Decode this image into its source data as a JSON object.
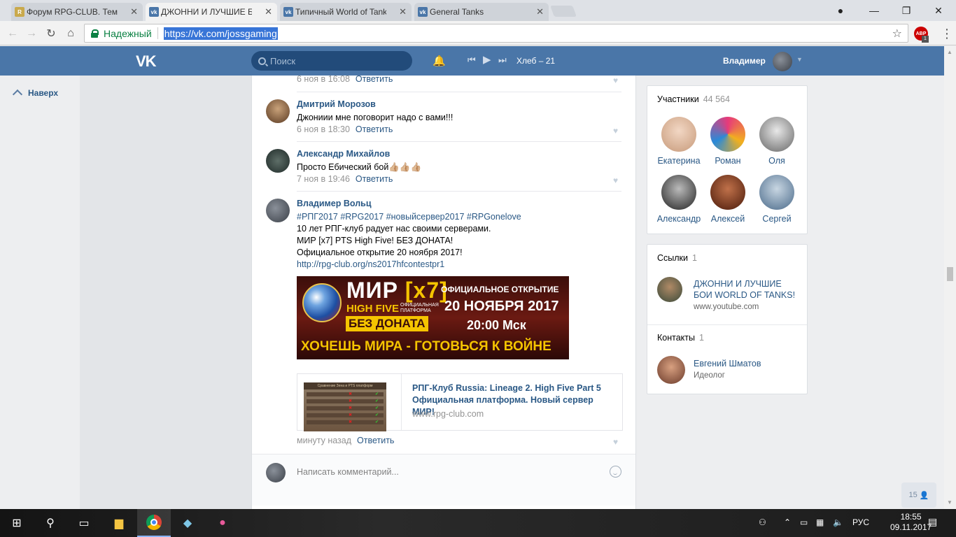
{
  "browser": {
    "tabs": [
      {
        "title": "Форум RPG-CLUB. Тема",
        "favicon": "rpg",
        "active": false
      },
      {
        "title": "ДЖОННИ И ЛУЧШИЕ Б",
        "favicon": "vk",
        "active": true
      },
      {
        "title": "Типичный World of Tank",
        "favicon": "vk",
        "active": false
      },
      {
        "title": "General Tanks",
        "favicon": "vk",
        "active": false
      }
    ],
    "secure_label": "Надежный",
    "url": "https://vk.com/jossgaming",
    "ext_badge": "ABP",
    "ext_count": "1"
  },
  "vk": {
    "search_placeholder": "Поиск",
    "now_playing": "Хлеб – 21",
    "user_name": "Владимер",
    "back_to_top": "Наверх"
  },
  "comments": [
    {
      "meta": "6 ноя в 16:08",
      "reply": "Ответить"
    },
    {
      "author": "Дмитрий Морозов",
      "text": "Джониии мне поговорит надо с вами!!!",
      "meta": "6 ноя в 18:30",
      "reply": "Ответить"
    },
    {
      "author": "Александр Михайлов",
      "text": "Просто Ебический бой👍🏼👍🏼👍🏼",
      "meta": "7 ноя в 19:46",
      "reply": "Ответить"
    },
    {
      "author": "Владимер Вольц",
      "hashtags": "#РПГ2017 #RPG2017 #новыйсервер2017 #RPGonelove",
      "line1": "10 лет РПГ-клуб радует нас своими серверами.",
      "line2": "МИР [x7] PTS High Five! БЕЗ ДОНАТА!",
      "line3": "Официальное открытие 20 ноября 2017!",
      "link": "http://rpg-club.org/ns2017hfcontestpr1",
      "meta": "минуту назад",
      "reply": "Ответить"
    }
  ],
  "banner": {
    "mir": "МИР",
    "x7": "[x7]",
    "high_five": "HIGH FIVE",
    "platform": "ОФИЦИАЛЬНАЯ ПЛАТФОРМА",
    "no_donate": "БЕЗ ДОНАТА",
    "official_opening": "ОФИЦИАЛЬНОЕ ОТКРЫТИЕ",
    "date": "20 НОЯБРЯ 2017",
    "time": "20:00 Мск",
    "slogan": "ХОЧЕШЬ МИРА - ГОТОВЬСЯ К ВОЙНЕ"
  },
  "snippet": {
    "title": "РПГ-Клуб Russia: Lineage 2. High Five Part 5 Официальная платформа. Новый сервер МИР!",
    "domain": "www.rpg-club.com",
    "thumb_header": "Сравнение Зена и PTS платформ"
  },
  "composer": {
    "placeholder": "Написать комментарий..."
  },
  "members": {
    "label": "Участники",
    "count": "44 564",
    "people": [
      {
        "name": "Екатерина",
        "color": "#d9b9a0"
      },
      {
        "name": "Роман",
        "color": "#d84a7a"
      },
      {
        "name": "Оля",
        "color": "#9a9a9a"
      },
      {
        "name": "Александр",
        "color": "#3a3a3a"
      },
      {
        "name": "Алексей",
        "color": "#7a3a22"
      },
      {
        "name": "Сергей",
        "color": "#6f8aa5"
      }
    ]
  },
  "links": {
    "label": "Ссылки",
    "count": "1",
    "title": "ДЖОННИ И ЛУЧШИЕ БОИ WORLD OF TANKS!",
    "site": "www.youtube.com"
  },
  "contacts": {
    "label": "Контакты",
    "count": "1",
    "name": "Евгений Шматов",
    "role": "Идеолог"
  },
  "chat_count": "15",
  "taskbar": {
    "lang": "РУС",
    "time": "18:55",
    "date": "09.11.2017"
  }
}
